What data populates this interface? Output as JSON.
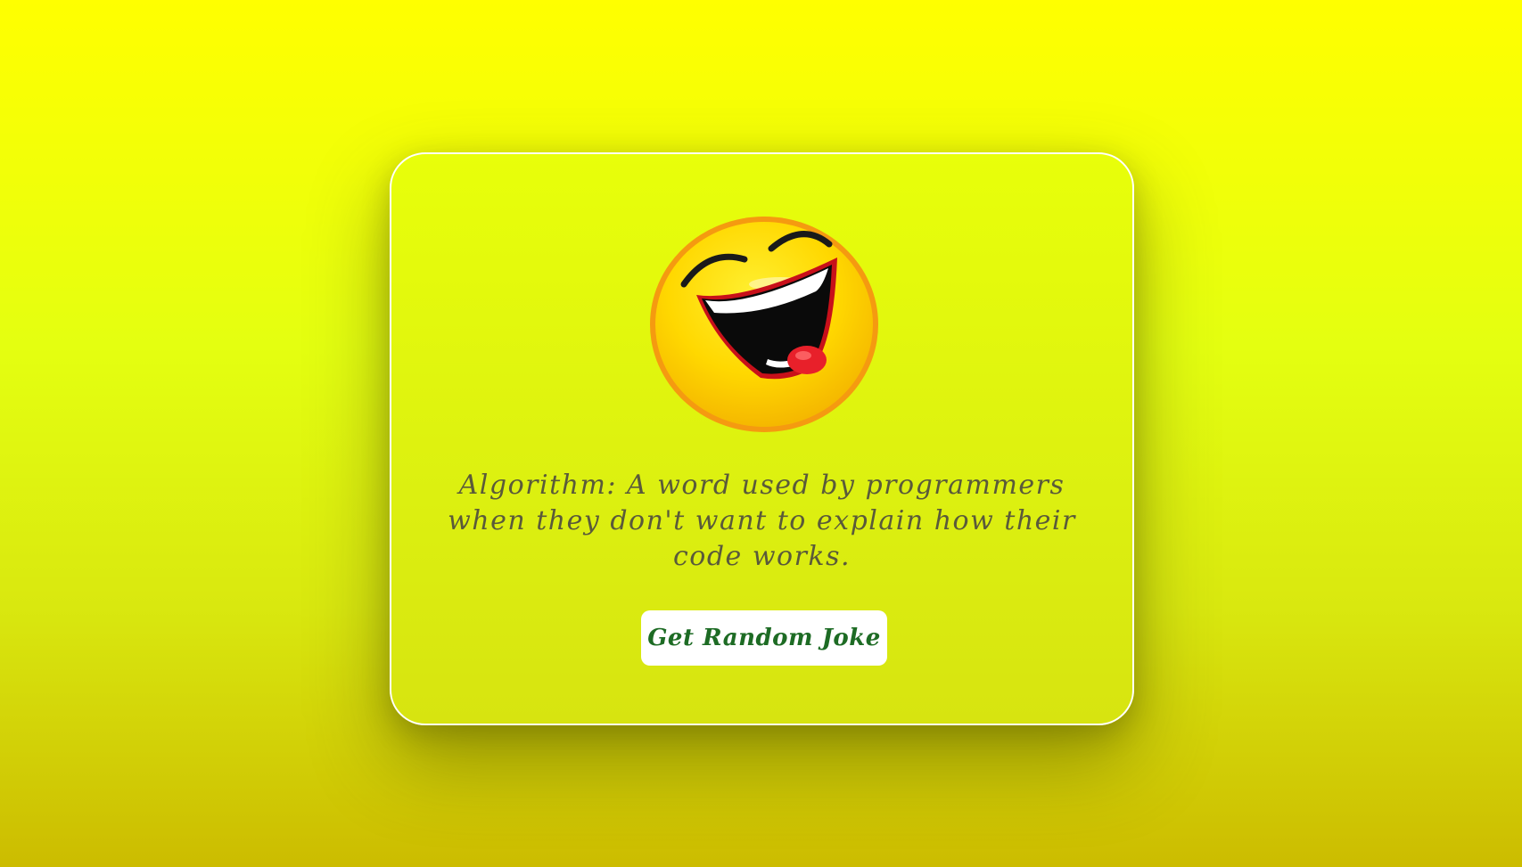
{
  "joke": {
    "text": "Algorithm: A word used by programmers when they don't want to explain how their code works."
  },
  "button": {
    "label": "Get Random Joke"
  },
  "image": {
    "icon": "laughing-face-icon"
  },
  "colors": {
    "background_top": "#ffff00",
    "background_bottom": "#ccbc00",
    "card": "#e4ff0c",
    "button_text": "#1d6b24",
    "joke_text": "#5a5a3a"
  }
}
